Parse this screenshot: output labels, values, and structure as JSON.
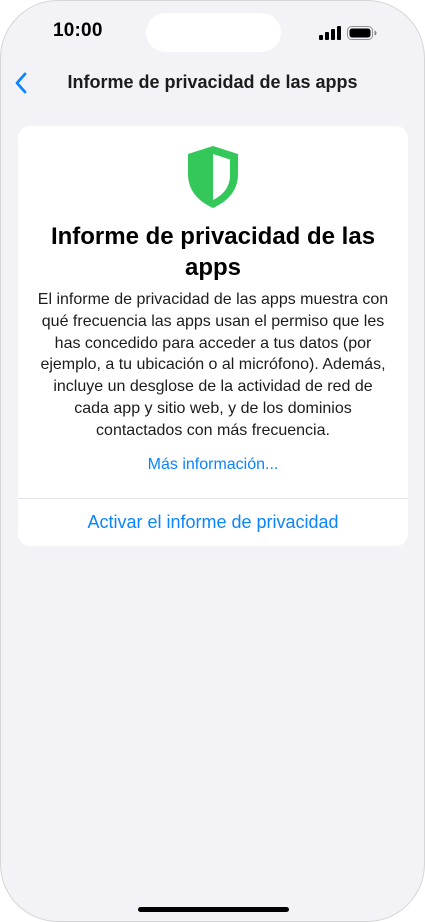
{
  "status_bar": {
    "time": "10:00",
    "icons": [
      "signal-icon",
      "battery-icon"
    ]
  },
  "nav": {
    "back_icon": "chevron-left-icon",
    "title": "Informe de privacidad de las apps"
  },
  "card": {
    "icon": "shield-icon",
    "title": "Informe de privacidad de las apps",
    "body": "El informe de privacidad de las apps muestra con qué frecuencia las apps usan el permiso que les has concedido para acceder a tus datos (por ejemplo, a tu ubicación o al micrófono). Además, incluye un desglose de la actividad de red de cada app y sitio web, y de los dominios contactados con más frecuencia.",
    "more_link": "Más información...",
    "activate_button": "Activar el informe de privacidad"
  },
  "colors": {
    "accent": "#0a84ff",
    "shield_green": "#34c759",
    "background": "#f2f2f7"
  }
}
